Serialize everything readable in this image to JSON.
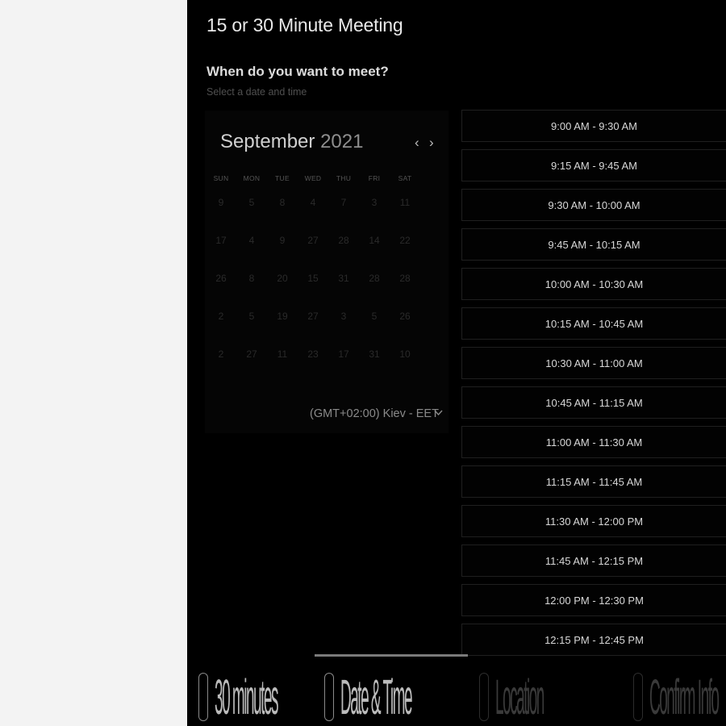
{
  "meeting": {
    "title": "15 or 30 Minute Meeting",
    "prompt": "When do you want to meet?",
    "subprompt": "Select a date and time"
  },
  "calendar": {
    "month": "September",
    "year": "2021",
    "weekdays": [
      "SUN",
      "MON",
      "TUE",
      "WED",
      "THU",
      "FRI",
      "SAT"
    ],
    "weeks": [
      [
        "9",
        "5",
        "8",
        "4",
        "7",
        "3",
        "11"
      ],
      [
        "17",
        "4",
        "9",
        "27",
        "28",
        "14",
        "22"
      ],
      [
        "26",
        "8",
        "20",
        "15",
        "31",
        "28",
        "28"
      ],
      [
        "2",
        "5",
        "19",
        "27",
        "3",
        "5",
        "26"
      ],
      [
        "2",
        "27",
        "11",
        "23",
        "17",
        "31",
        "10"
      ]
    ]
  },
  "timezone": {
    "label": "(GMT+02:00) Kiev - EET"
  },
  "time_slots": [
    "9:00 AM - 9:30 AM",
    "9:15 AM - 9:45 AM",
    "9:30 AM - 10:00 AM",
    "9:45 AM - 10:15 AM",
    "10:00 AM - 10:30 AM",
    "10:15 AM - 10:45 AM",
    "10:30 AM - 11:00 AM",
    "10:45 AM - 11:15 AM",
    "11:00 AM - 11:30 AM",
    "11:15 AM - 11:45 AM",
    "11:30 AM - 12:00 PM",
    "11:45 AM - 12:15 PM",
    "12:00 PM - 12:30 PM",
    "12:15 PM - 12:45 PM"
  ],
  "steps": [
    "30 minutes",
    "Date & Time",
    "Location",
    "Confirm Info"
  ]
}
